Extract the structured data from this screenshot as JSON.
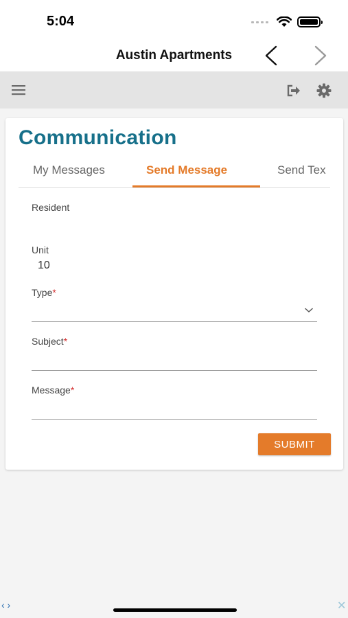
{
  "status_bar": {
    "time": "5:04"
  },
  "nav": {
    "title": "Austin Apartments"
  },
  "toolbar": {
    "menu_icon": "menu-icon",
    "logout_icon": "logout-icon",
    "settings_icon": "gear-icon"
  },
  "page": {
    "title": "Communication",
    "tabs": [
      {
        "label": "My Messages",
        "active": false
      },
      {
        "label": "Send Message",
        "active": true
      },
      {
        "label": "Send Tex",
        "active": false
      }
    ]
  },
  "form": {
    "resident": {
      "label": "Resident",
      "value": ""
    },
    "unit": {
      "label": "Unit",
      "value": "10"
    },
    "type": {
      "label": "Type",
      "required_mark": "*",
      "value": ""
    },
    "subject": {
      "label": "Subject",
      "required_mark": "*",
      "value": ""
    },
    "message": {
      "label": "Message",
      "required_mark": "*",
      "value": ""
    },
    "submit_label": "SUBMIT"
  },
  "bottom": {
    "nav_arrows": "‹ ›",
    "close": "✕"
  },
  "colors": {
    "accent_orange": "#e47b2a",
    "title_teal": "#17708a",
    "required_red": "#d32f2f"
  }
}
